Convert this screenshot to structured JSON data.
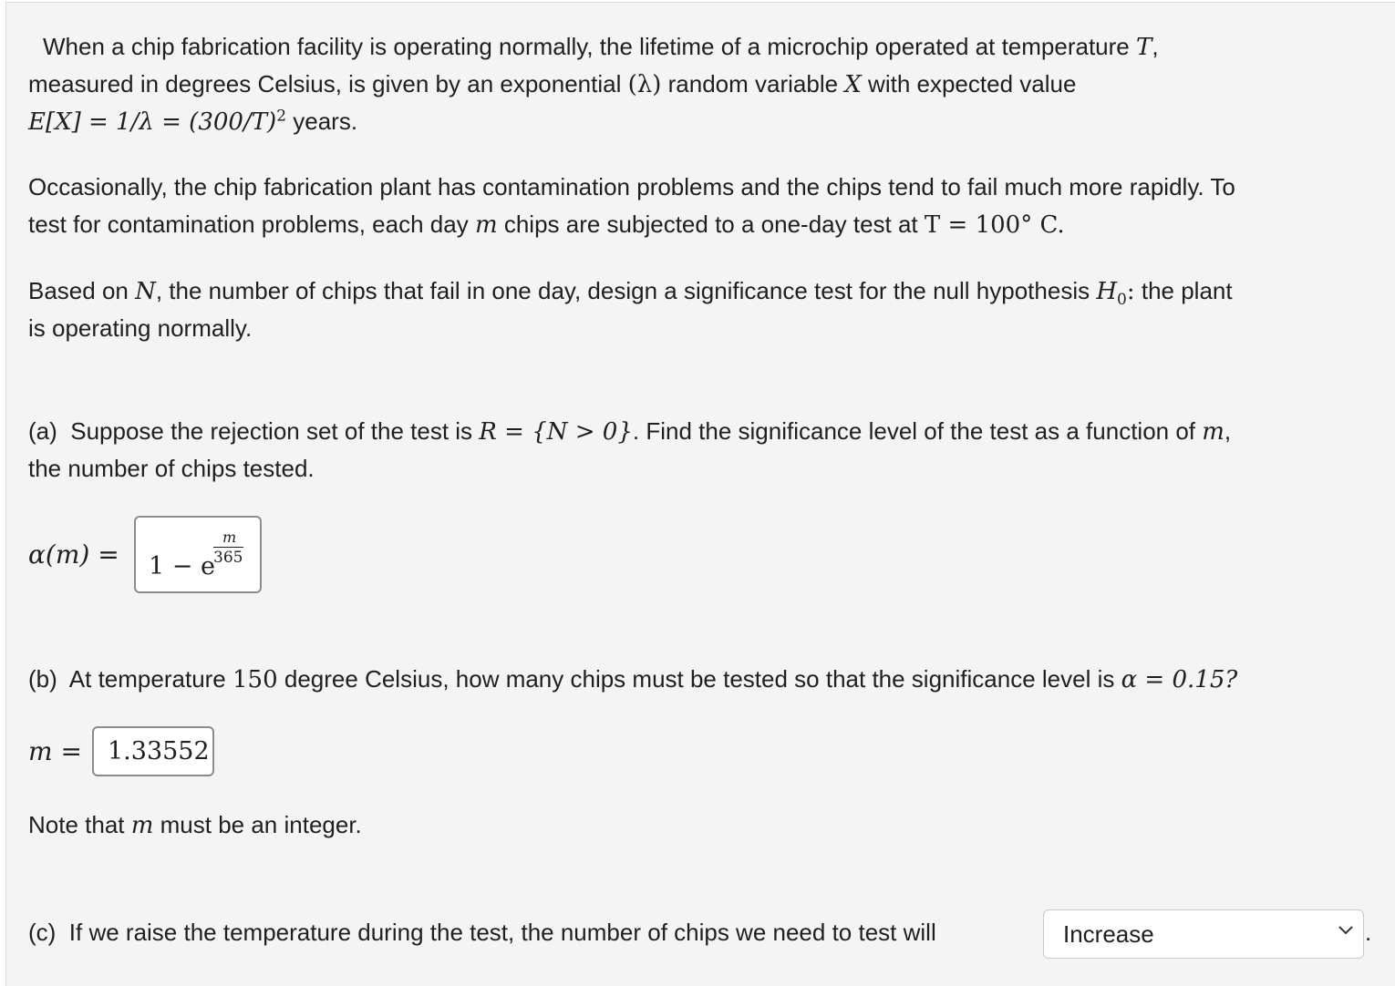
{
  "problem": {
    "intro": {
      "l1_a": "When a chip fabrication facility is operating normally, the lifetime of a microchip operated at temperature",
      "l1_var": "T",
      "l1_end": ",",
      "l2_a": "measured in degrees Celsius, is given by an exponential",
      "l2_lambda": "(λ)",
      "l2_b": "random variable",
      "l2_var": "X",
      "l2_c": "with expected value",
      "l3_formula_a": "E[X] = 1/λ = (300/T)",
      "l3_exp": "2",
      "l3_end": "years."
    },
    "para2": {
      "l1": "Occasionally, the chip fabrication plant has contamination problems and the chips tend to fail much more rapidly. To",
      "l2_a": "test for contamination problems, each day",
      "l2_var": "m",
      "l2_b": "chips are subjected to a one-day test at",
      "l2_formula": "T = 100° C."
    },
    "para3": {
      "l1_a": "Based on",
      "l1_var": "N",
      "l1_b": ", the number of chips that fail in one day, design a significance test for the null hypothesis",
      "l1_h": "H",
      "l1_hsub": "0",
      "l1_colon": ":",
      "l1_c": "the plant",
      "l2": "is operating normally."
    }
  },
  "part_a": {
    "label": "(a)",
    "text_a": "Suppose the rejection set of the test is",
    "formula": "R = {N > 0}",
    "text_b": ". Find the significance level of the test as a function of",
    "var": "m",
    "text_c": ",",
    "l2": "the number of chips tested.",
    "answer_label": "α(m) =",
    "answer": {
      "one_minus": "1 − e",
      "exp_num": "m",
      "exp_den": "365"
    }
  },
  "part_b": {
    "label": "(b)",
    "text_a": "At temperature",
    "temp": "150",
    "text_b": "degree Celsius, how many chips must be tested so that the significance level is",
    "alpha": "α = 0.15?",
    "answer_label": "m =",
    "answer_value": "1.33552",
    "note_a": "Note that",
    "note_var": "m",
    "note_b": "must be an integer."
  },
  "part_c": {
    "label": "(c)",
    "text": "If we raise the temperature during the test, the number of chips we need to test will",
    "selected": "Increase",
    "trailing": "."
  }
}
